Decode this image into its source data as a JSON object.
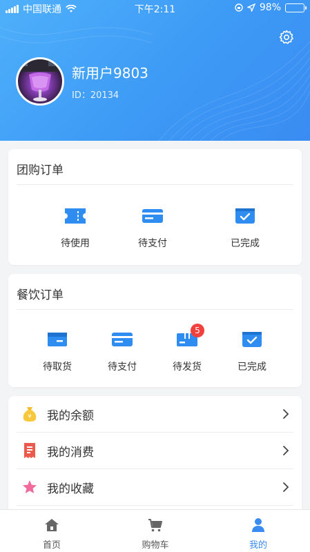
{
  "status_bar": {
    "carrier": "中国联通",
    "time": "下午2:11",
    "battery": "98%",
    "battery_level": 0.98
  },
  "profile": {
    "username": "新用户9803",
    "user_id": "ID：20134"
  },
  "group_orders": {
    "title": "团购订单",
    "items": [
      {
        "label": "待使用",
        "icon": "ticket-icon"
      },
      {
        "label": "待支付",
        "icon": "card-icon"
      },
      {
        "label": "已完成",
        "icon": "check-box-icon"
      }
    ]
  },
  "food_orders": {
    "title": "餐饮订单",
    "items": [
      {
        "label": "待取货",
        "icon": "box-icon"
      },
      {
        "label": "待支付",
        "icon": "card-icon"
      },
      {
        "label": "待发货",
        "icon": "package-icon",
        "badge": "5"
      },
      {
        "label": "已完成",
        "icon": "check-box-icon"
      }
    ]
  },
  "menu": [
    {
      "label": "我的余额",
      "icon": "money-bag-icon"
    },
    {
      "label": "我的消费",
      "icon": "receipt-icon"
    },
    {
      "label": "我的收藏",
      "icon": "star-icon"
    }
  ],
  "tabbar": [
    {
      "label": "首页",
      "icon": "home-icon"
    },
    {
      "label": "购物车",
      "icon": "cart-icon"
    },
    {
      "label": "我的",
      "icon": "user-icon",
      "active": true
    }
  ],
  "colors": {
    "primary": "#3a8cf2",
    "badge": "#f0413c",
    "header_start": "#4fb0fb",
    "header_end": "#3a8cf2"
  }
}
